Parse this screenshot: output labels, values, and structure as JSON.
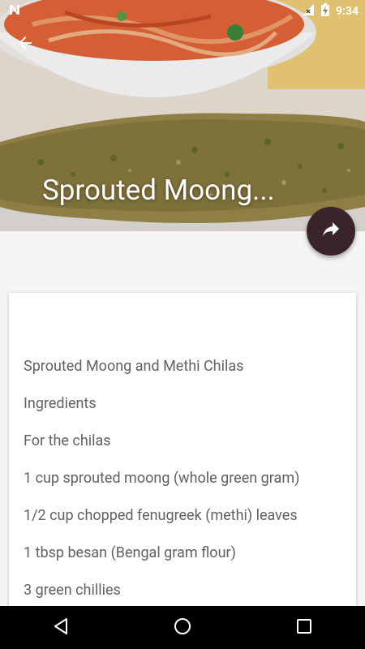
{
  "status_bar": {
    "time": "9:34",
    "icons": [
      "notification-n-icon",
      "signal-no-data-icon",
      "battery-charging-icon"
    ]
  },
  "header": {
    "title": "Sprouted Moong...",
    "back_icon": "arrow-left-icon",
    "share_icon": "share-arrow-icon"
  },
  "content": {
    "lines": [
      "Sprouted Moong and Methi Chilas",
      "Ingredients",
      "For the chilas",
      "1 cup sprouted moong (whole green gram)",
      "1/2 cup chopped fenugreek (methi) leaves",
      "1 tbsp besan (Bengal gram flour)",
      "3 green chillies"
    ]
  },
  "nav_bar": {
    "icons": [
      "back-triangle-icon",
      "home-circle-icon",
      "recents-square-icon"
    ]
  },
  "colors": {
    "fab": "#3b2429",
    "text": "#616161",
    "page_bg": "#f5f5f5"
  }
}
